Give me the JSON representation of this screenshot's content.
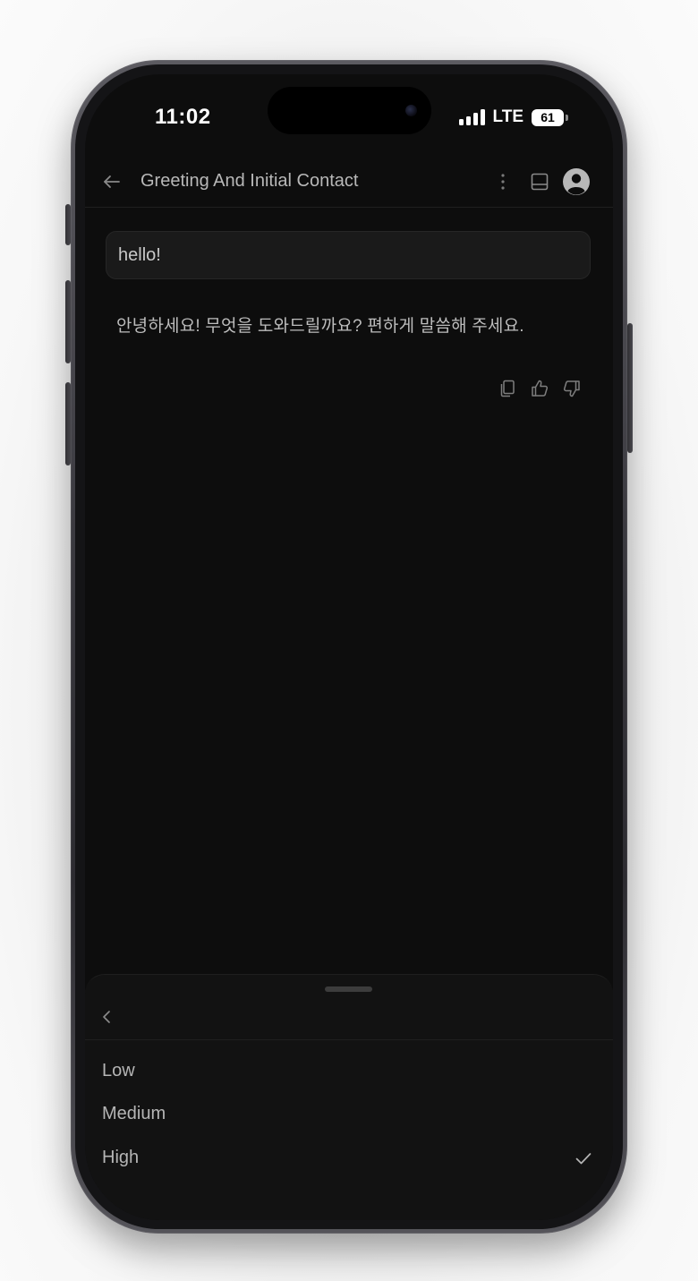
{
  "status_bar": {
    "time": "11:02",
    "network": "LTE",
    "battery": "61"
  },
  "header": {
    "title": "Greeting And Initial Contact"
  },
  "messages": {
    "user": "hello!",
    "assistant": "안녕하세요! 무엇을 도와드릴까요? 편하게 말씀해 주세요."
  },
  "sheet": {
    "options": [
      {
        "label": "Low",
        "selected": false
      },
      {
        "label": "Medium",
        "selected": false
      },
      {
        "label": "High",
        "selected": true
      }
    ]
  },
  "icons": {
    "back": "arrow-left-icon",
    "more": "kebab-menu-icon",
    "sidebar": "sidebar-icon",
    "avatar": "user-avatar-icon",
    "copy": "copy-icon",
    "like": "thumbs-up-icon",
    "dislike": "thumbs-down-icon",
    "sheet_back": "chevron-left-icon",
    "check": "checkmark-icon"
  },
  "colors": {
    "background": "#0d0d0d",
    "sheet": "#121212",
    "bubble": "#1a1a1a",
    "text": "#bdbdbd"
  }
}
